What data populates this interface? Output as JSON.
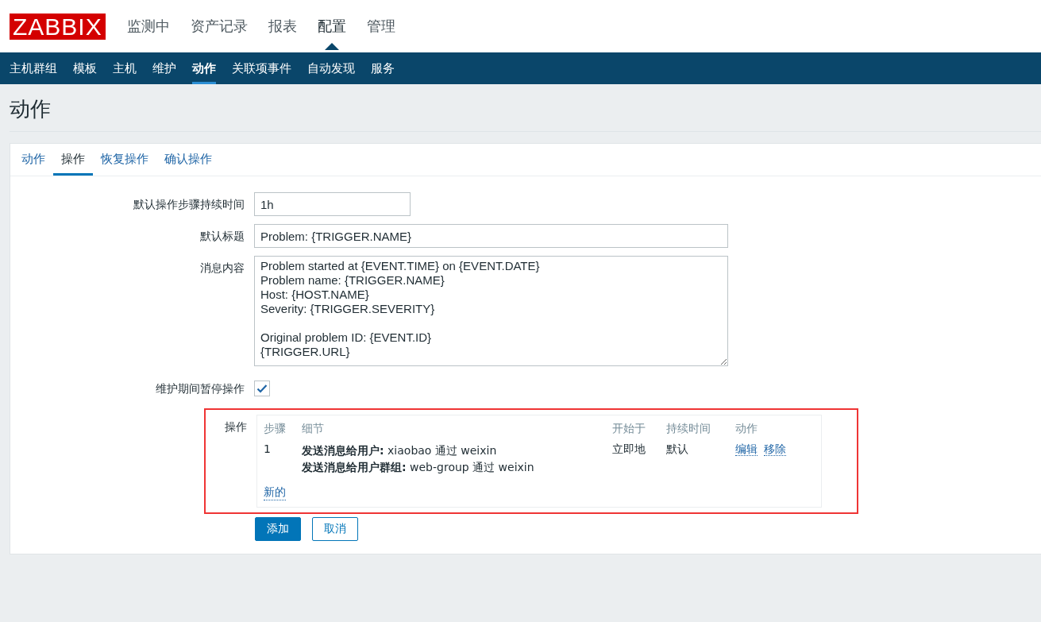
{
  "header": {
    "logo": "ZABBIX",
    "menu": [
      {
        "label": "监测中",
        "selected": false
      },
      {
        "label": "资产记录",
        "selected": false
      },
      {
        "label": "报表",
        "selected": false
      },
      {
        "label": "配置",
        "selected": true
      },
      {
        "label": "管理",
        "selected": false
      }
    ]
  },
  "submenu": [
    {
      "label": "主机群组",
      "selected": false
    },
    {
      "label": "模板",
      "selected": false
    },
    {
      "label": "主机",
      "selected": false
    },
    {
      "label": "维护",
      "selected": false
    },
    {
      "label": "动作",
      "selected": true
    },
    {
      "label": "关联项事件",
      "selected": false
    },
    {
      "label": "自动发现",
      "selected": false
    },
    {
      "label": "服务",
      "selected": false
    }
  ],
  "page_title": "动作",
  "tabs": [
    {
      "label": "动作",
      "selected": false
    },
    {
      "label": "操作",
      "selected": true
    },
    {
      "label": "恢复操作",
      "selected": false
    },
    {
      "label": "确认操作",
      "selected": false
    }
  ],
  "fields": [
    {
      "kind": "short_input",
      "label": "默认操作步骤持续时间",
      "value": "1h"
    },
    {
      "kind": "long_input",
      "label": "默认标题",
      "value": "Problem: {TRIGGER.NAME}"
    },
    {
      "kind": "textarea",
      "label": "消息内容",
      "value": "Problem started at {EVENT.TIME} on {EVENT.DATE}\nProblem name: {TRIGGER.NAME}\nHost: {HOST.NAME}\nSeverity: {TRIGGER.SEVERITY}\n\nOriginal problem ID: {EVENT.ID}\n{TRIGGER.URL}"
    },
    {
      "kind": "checkbox",
      "label": "维护期间暂停操作",
      "checked": true
    }
  ],
  "operations": {
    "label": "操作",
    "highlighted": true,
    "columns": [
      "步骤",
      "细节",
      "开始于",
      "持续时间",
      "动作"
    ],
    "rows": [
      {
        "step": "1",
        "details": [
          "**发送消息给用户:** xiaobao 通过 weixin",
          "**发送消息给用户群组:** web-group 通过 weixin"
        ],
        "start": "立即地",
        "duration": "默认",
        "actions": [
          "编辑",
          "移除"
        ]
      }
    ],
    "new_link": "新的"
  },
  "buttons": [
    {
      "label": "添加",
      "kind": "primary"
    },
    {
      "label": "取消",
      "kind": "secondary"
    }
  ]
}
